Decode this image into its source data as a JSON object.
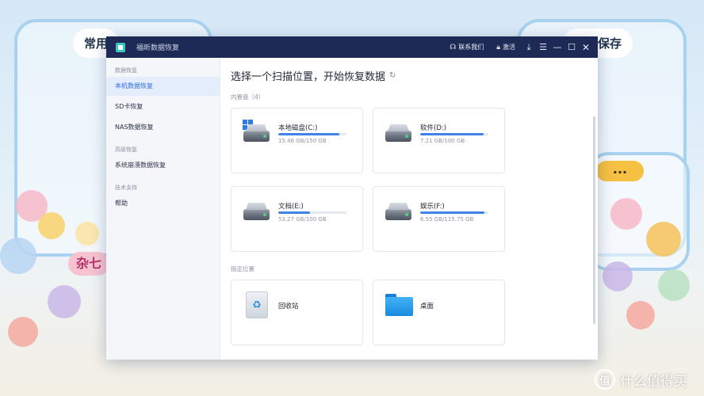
{
  "wallpaper": {
    "tag_left": "常用",
    "tag_right": "临时保存",
    "bubble": "...",
    "pill": "杂七",
    "watermark_text": "什么值得买",
    "watermark_logo": "值"
  },
  "window": {
    "title": "福昕数据恢复",
    "contact_label": "联系我们",
    "activate_label": "激活",
    "icons": {
      "contact": "headset-icon",
      "activate": "lock-icon",
      "download": "download-icon",
      "menu": "menu-icon",
      "minimize": "minimize-icon",
      "maximize": "maximize-icon",
      "close": "close-icon"
    }
  },
  "sidebar": {
    "groups": [
      {
        "label": "数据恢复",
        "items": [
          {
            "label": "本机数据恢复",
            "active": true
          },
          {
            "label": "SD卡恢复"
          },
          {
            "label": "NAS数据恢复"
          }
        ]
      },
      {
        "label": "高级恢复",
        "items": [
          {
            "label": "系统崩溃数据恢复"
          }
        ]
      },
      {
        "label": "技术支持",
        "items": [
          {
            "label": "帮助"
          }
        ]
      }
    ]
  },
  "main": {
    "heading": "选择一个扫描位置，开始恢复数据",
    "refresh_glyph": "↻",
    "internal_section": "内置盘（4）",
    "drives": [
      {
        "name": "本地磁盘(C:)",
        "size": "15.46 GB/150 GB",
        "used_fraction": 0.9,
        "system": true
      },
      {
        "name": "软件(D:)",
        "size": "7.21 GB/100 GB",
        "used_fraction": 0.93
      },
      {
        "name": "文档(E:)",
        "size": "53.27 GB/100 GB",
        "used_fraction": 0.47
      },
      {
        "name": "娱乐(F:)",
        "size": "6.55 GB/115.75 GB",
        "used_fraction": 0.94
      }
    ],
    "specified_section": "指定位置",
    "locations": [
      {
        "name": "回收站",
        "icon": "recycle-bin-icon"
      },
      {
        "name": "桌面",
        "icon": "folder-icon"
      }
    ]
  },
  "colors": {
    "titlebar": "#1c2a55",
    "accent": "#3f82e8",
    "sidebar_active": "#e3edfc"
  }
}
